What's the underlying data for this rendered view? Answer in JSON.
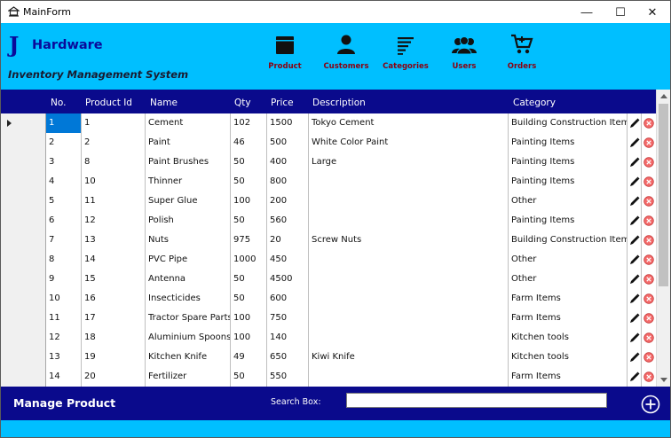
{
  "window": {
    "title": "MainForm",
    "minimize_glyph": "—",
    "maximize_glyph": "☐",
    "close_glyph": "✕"
  },
  "header": {
    "logo_letter": "J",
    "brand": "Hardware",
    "subtitle": "Inventory Management System",
    "bg_color": "#00bfff",
    "nav": [
      {
        "label": "Product",
        "icon": "product-icon"
      },
      {
        "label": "Customers",
        "icon": "customer-icon"
      },
      {
        "label": "Categories",
        "icon": "categories-icon"
      },
      {
        "label": "Users",
        "icon": "users-icon"
      },
      {
        "label": "Orders",
        "icon": "cart-icon"
      }
    ]
  },
  "grid": {
    "header_color": "#0a0a8c",
    "columns": [
      "No.",
      "Product Id",
      "Name",
      "Qty",
      "Price",
      "Description",
      "Category"
    ],
    "selected_row": 0,
    "rows": [
      {
        "no": "1",
        "pid": "1",
        "name": "Cement",
        "qty": "102",
        "price": "1500",
        "desc": "Tokyo Cement",
        "cat": "Building Construction Items"
      },
      {
        "no": "2",
        "pid": "2",
        "name": "Paint",
        "qty": "46",
        "price": "500",
        "desc": "White Color Paint",
        "cat": "Painting Items"
      },
      {
        "no": "3",
        "pid": "8",
        "name": "Paint Brushes",
        "qty": "50",
        "price": "400",
        "desc": "Large",
        "cat": "Painting Items"
      },
      {
        "no": "4",
        "pid": "10",
        "name": "Thinner",
        "qty": "50",
        "price": "800",
        "desc": "",
        "cat": "Painting Items"
      },
      {
        "no": "5",
        "pid": "11",
        "name": "Super Glue",
        "qty": "100",
        "price": "200",
        "desc": "",
        "cat": "Other"
      },
      {
        "no": "6",
        "pid": "12",
        "name": "Polish",
        "qty": "50",
        "price": "560",
        "desc": "",
        "cat": "Painting Items"
      },
      {
        "no": "7",
        "pid": "13",
        "name": "Nuts",
        "qty": "975",
        "price": "20",
        "desc": "Screw Nuts",
        "cat": "Building Construction Items"
      },
      {
        "no": "8",
        "pid": "14",
        "name": "PVC Pipe",
        "qty": "1000",
        "price": "450",
        "desc": "",
        "cat": "Other"
      },
      {
        "no": "9",
        "pid": "15",
        "name": "Antenna",
        "qty": "50",
        "price": "4500",
        "desc": "",
        "cat": "Other"
      },
      {
        "no": "10",
        "pid": "16",
        "name": "Insecticides",
        "qty": "50",
        "price": "600",
        "desc": "",
        "cat": "Farm Items"
      },
      {
        "no": "11",
        "pid": "17",
        "name": "Tractor Spare Parts",
        "qty": "100",
        "price": "750",
        "desc": "",
        "cat": "Farm Items"
      },
      {
        "no": "12",
        "pid": "18",
        "name": "Aluminium Spoons",
        "qty": "100",
        "price": "140",
        "desc": "",
        "cat": "Kitchen tools"
      },
      {
        "no": "13",
        "pid": "19",
        "name": "Kitchen Knife",
        "qty": "49",
        "price": "650",
        "desc": "Kiwi Knife",
        "cat": "Kitchen tools"
      },
      {
        "no": "14",
        "pid": "20",
        "name": "Fertilizer",
        "qty": "50",
        "price": "550",
        "desc": "",
        "cat": "Farm Items"
      }
    ]
  },
  "footer": {
    "title": "Manage Product",
    "search_label": "Search Box:",
    "search_value": ""
  }
}
